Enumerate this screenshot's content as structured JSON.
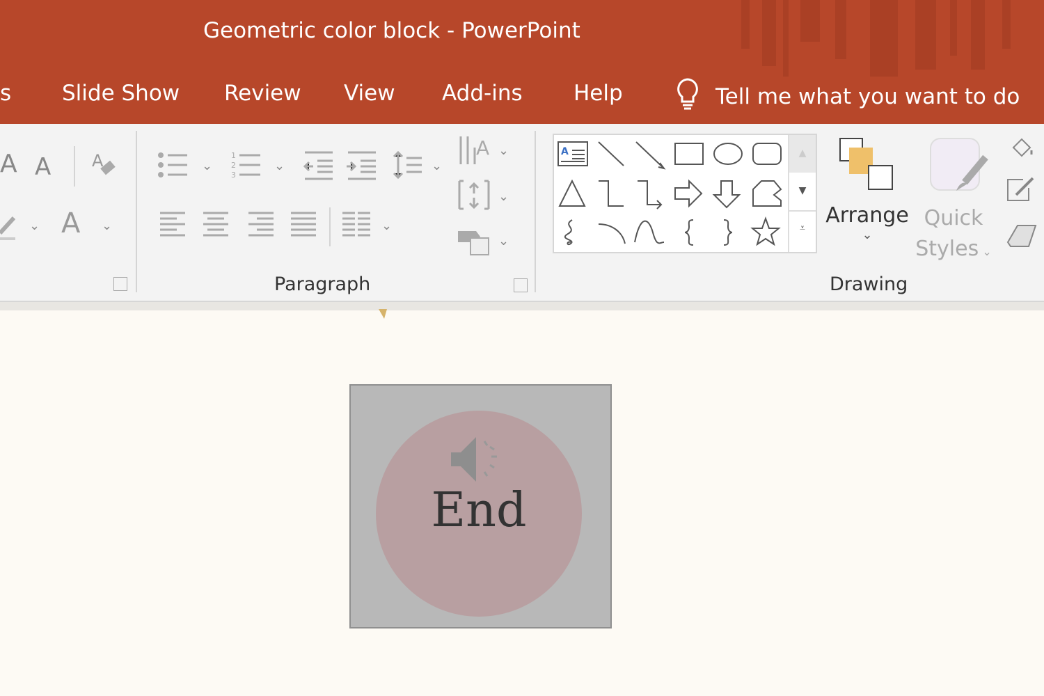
{
  "window": {
    "title": "Geometric color block  -  PowerPoint"
  },
  "tabs": [
    {
      "label": "s"
    },
    {
      "label": "Slide Show"
    },
    {
      "label": "Review"
    },
    {
      "label": "View"
    },
    {
      "label": "Add-ins"
    },
    {
      "label": "Help"
    }
  ],
  "tellme": {
    "label": "Tell me what you want to do",
    "icon": "lightbulb-icon"
  },
  "ribbon": {
    "groups": {
      "paragraph": "Paragraph",
      "drawing": "Drawing"
    },
    "arrange": "Arrange",
    "quick_styles_1": "Quick",
    "quick_styles_2": "Styles",
    "shapes": [
      "text-box",
      "line",
      "arrow",
      "rectangle",
      "oval",
      "rounded-rectangle",
      "triangle",
      "elbow-connector",
      "elbow-arrow-connector",
      "right-arrow",
      "down-arrow",
      "freeform",
      "scribble",
      "arc",
      "curve",
      "left-brace",
      "right-brace",
      "star"
    ]
  },
  "slide": {
    "button_text": "End",
    "icon": "speaker-icon",
    "colors": {
      "box": "#b8b8b8",
      "circle": "#b89fa1"
    }
  },
  "colors": {
    "accent": "#b7472a",
    "ribbon": "#f3f3f3",
    "canvas": "#fdfaf4"
  }
}
